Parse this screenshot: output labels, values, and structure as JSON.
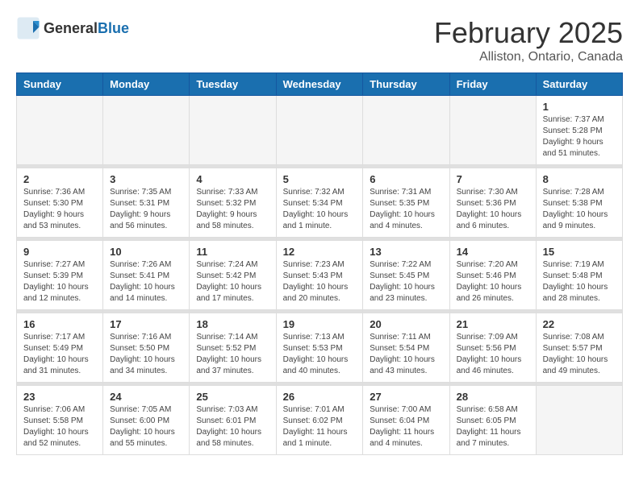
{
  "header": {
    "logo_general": "General",
    "logo_blue": "Blue",
    "main_title": "February 2025",
    "subtitle": "Alliston, Ontario, Canada"
  },
  "days_of_week": [
    "Sunday",
    "Monday",
    "Tuesday",
    "Wednesday",
    "Thursday",
    "Friday",
    "Saturday"
  ],
  "weeks": [
    [
      {
        "day": "",
        "info": ""
      },
      {
        "day": "",
        "info": ""
      },
      {
        "day": "",
        "info": ""
      },
      {
        "day": "",
        "info": ""
      },
      {
        "day": "",
        "info": ""
      },
      {
        "day": "",
        "info": ""
      },
      {
        "day": "1",
        "info": "Sunrise: 7:37 AM\nSunset: 5:28 PM\nDaylight: 9 hours and 51 minutes."
      }
    ],
    [
      {
        "day": "2",
        "info": "Sunrise: 7:36 AM\nSunset: 5:30 PM\nDaylight: 9 hours and 53 minutes."
      },
      {
        "day": "3",
        "info": "Sunrise: 7:35 AM\nSunset: 5:31 PM\nDaylight: 9 hours and 56 minutes."
      },
      {
        "day": "4",
        "info": "Sunrise: 7:33 AM\nSunset: 5:32 PM\nDaylight: 9 hours and 58 minutes."
      },
      {
        "day": "5",
        "info": "Sunrise: 7:32 AM\nSunset: 5:34 PM\nDaylight: 10 hours and 1 minute."
      },
      {
        "day": "6",
        "info": "Sunrise: 7:31 AM\nSunset: 5:35 PM\nDaylight: 10 hours and 4 minutes."
      },
      {
        "day": "7",
        "info": "Sunrise: 7:30 AM\nSunset: 5:36 PM\nDaylight: 10 hours and 6 minutes."
      },
      {
        "day": "8",
        "info": "Sunrise: 7:28 AM\nSunset: 5:38 PM\nDaylight: 10 hours and 9 minutes."
      }
    ],
    [
      {
        "day": "9",
        "info": "Sunrise: 7:27 AM\nSunset: 5:39 PM\nDaylight: 10 hours and 12 minutes."
      },
      {
        "day": "10",
        "info": "Sunrise: 7:26 AM\nSunset: 5:41 PM\nDaylight: 10 hours and 14 minutes."
      },
      {
        "day": "11",
        "info": "Sunrise: 7:24 AM\nSunset: 5:42 PM\nDaylight: 10 hours and 17 minutes."
      },
      {
        "day": "12",
        "info": "Sunrise: 7:23 AM\nSunset: 5:43 PM\nDaylight: 10 hours and 20 minutes."
      },
      {
        "day": "13",
        "info": "Sunrise: 7:22 AM\nSunset: 5:45 PM\nDaylight: 10 hours and 23 minutes."
      },
      {
        "day": "14",
        "info": "Sunrise: 7:20 AM\nSunset: 5:46 PM\nDaylight: 10 hours and 26 minutes."
      },
      {
        "day": "15",
        "info": "Sunrise: 7:19 AM\nSunset: 5:48 PM\nDaylight: 10 hours and 28 minutes."
      }
    ],
    [
      {
        "day": "16",
        "info": "Sunrise: 7:17 AM\nSunset: 5:49 PM\nDaylight: 10 hours and 31 minutes."
      },
      {
        "day": "17",
        "info": "Sunrise: 7:16 AM\nSunset: 5:50 PM\nDaylight: 10 hours and 34 minutes."
      },
      {
        "day": "18",
        "info": "Sunrise: 7:14 AM\nSunset: 5:52 PM\nDaylight: 10 hours and 37 minutes."
      },
      {
        "day": "19",
        "info": "Sunrise: 7:13 AM\nSunset: 5:53 PM\nDaylight: 10 hours and 40 minutes."
      },
      {
        "day": "20",
        "info": "Sunrise: 7:11 AM\nSunset: 5:54 PM\nDaylight: 10 hours and 43 minutes."
      },
      {
        "day": "21",
        "info": "Sunrise: 7:09 AM\nSunset: 5:56 PM\nDaylight: 10 hours and 46 minutes."
      },
      {
        "day": "22",
        "info": "Sunrise: 7:08 AM\nSunset: 5:57 PM\nDaylight: 10 hours and 49 minutes."
      }
    ],
    [
      {
        "day": "23",
        "info": "Sunrise: 7:06 AM\nSunset: 5:58 PM\nDaylight: 10 hours and 52 minutes."
      },
      {
        "day": "24",
        "info": "Sunrise: 7:05 AM\nSunset: 6:00 PM\nDaylight: 10 hours and 55 minutes."
      },
      {
        "day": "25",
        "info": "Sunrise: 7:03 AM\nSunset: 6:01 PM\nDaylight: 10 hours and 58 minutes."
      },
      {
        "day": "26",
        "info": "Sunrise: 7:01 AM\nSunset: 6:02 PM\nDaylight: 11 hours and 1 minute."
      },
      {
        "day": "27",
        "info": "Sunrise: 7:00 AM\nSunset: 6:04 PM\nDaylight: 11 hours and 4 minutes."
      },
      {
        "day": "28",
        "info": "Sunrise: 6:58 AM\nSunset: 6:05 PM\nDaylight: 11 hours and 7 minutes."
      },
      {
        "day": "",
        "info": ""
      }
    ]
  ]
}
